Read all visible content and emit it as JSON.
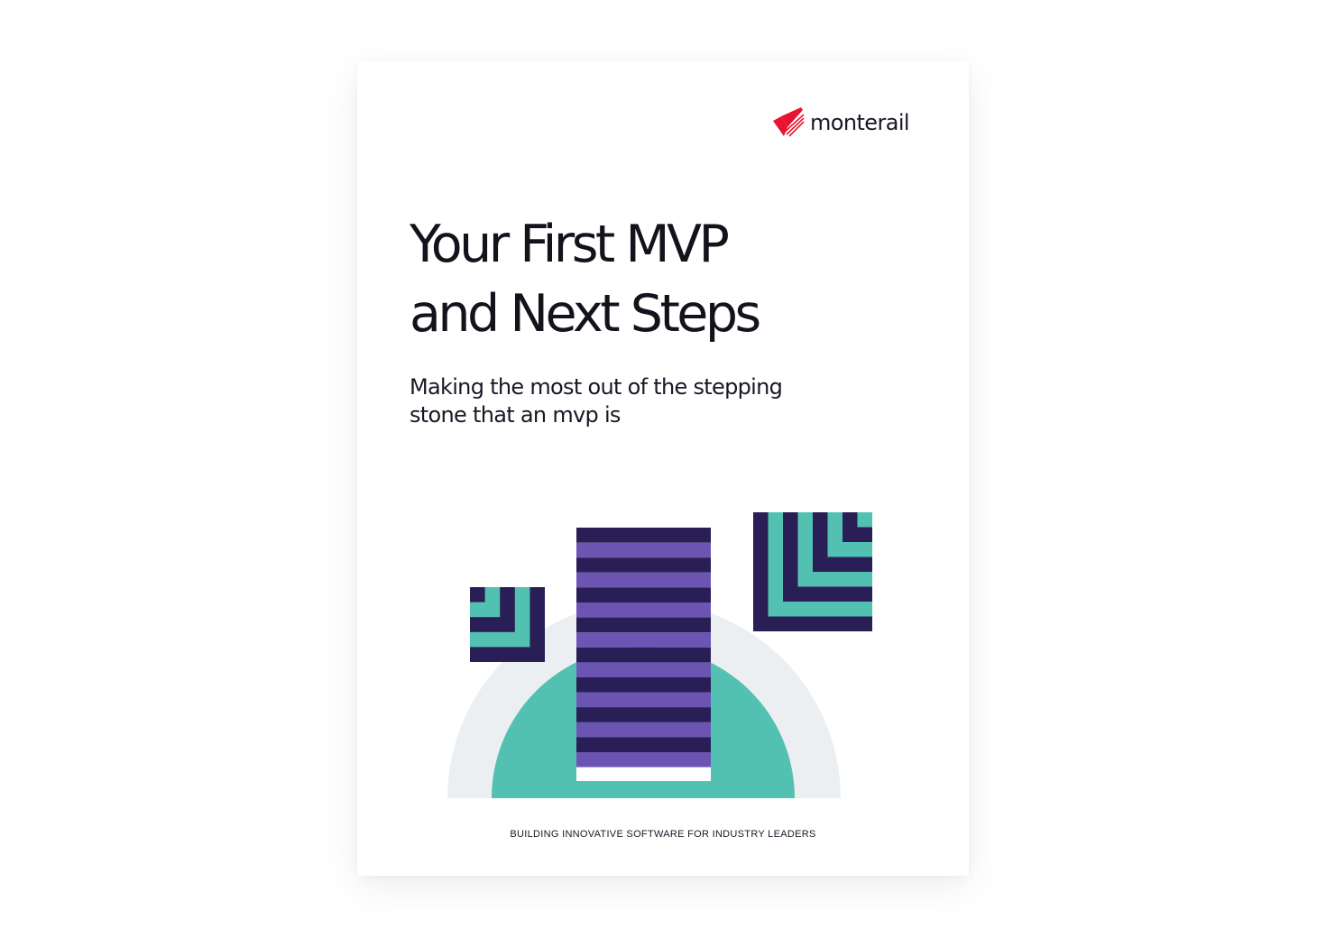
{
  "document": {
    "brand": {
      "name": "monterail",
      "icon": "monterail-logo-icon",
      "color": "#e8132f"
    },
    "title_lines": [
      "Your First MVP",
      "and Next Steps"
    ],
    "subtitle_lines": [
      "Making the most out of the stepping",
      "stone that an mvp is"
    ],
    "tagline": "BUILDING INNOVATIVE SOFTWARE FOR INDUSTRY LEADERS"
  },
  "palette": {
    "navy": "#2a1e57",
    "purple": "#6c55b2",
    "teal": "#53c1b2",
    "grey": "#eceff2",
    "text": "#16121c"
  }
}
